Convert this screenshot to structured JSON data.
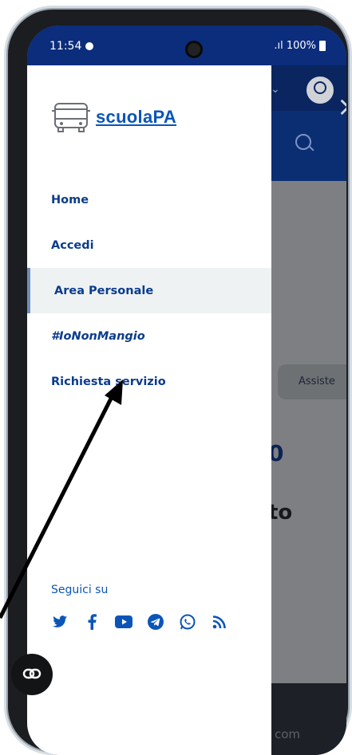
{
  "status_bar": {
    "time": "11:54",
    "battery": ".ıl 100%"
  },
  "brand": {
    "name": "scuolaPA"
  },
  "nav": {
    "items": [
      {
        "label": "Home"
      },
      {
        "label": "Accedi"
      },
      {
        "label": "Area Personale"
      },
      {
        "label": "#IoNonMangio"
      },
      {
        "label": "Richiesta servizio"
      }
    ]
  },
  "social": {
    "label": "Seguici su",
    "icons": [
      "twitter-icon",
      "facebook-icon",
      "youtube-icon",
      "telegram-icon",
      "whatsapp-icon",
      "rss-icon"
    ]
  },
  "background": {
    "assist_label": "Assiste",
    "number_fragment": "0",
    "word_fragment": "to",
    "footer_fragment": "com"
  },
  "colors": {
    "header": "#0b2d7c",
    "brand": "#0b55b8",
    "nav_text": "#0b3c8c",
    "active_bg": "#eef2f3"
  }
}
